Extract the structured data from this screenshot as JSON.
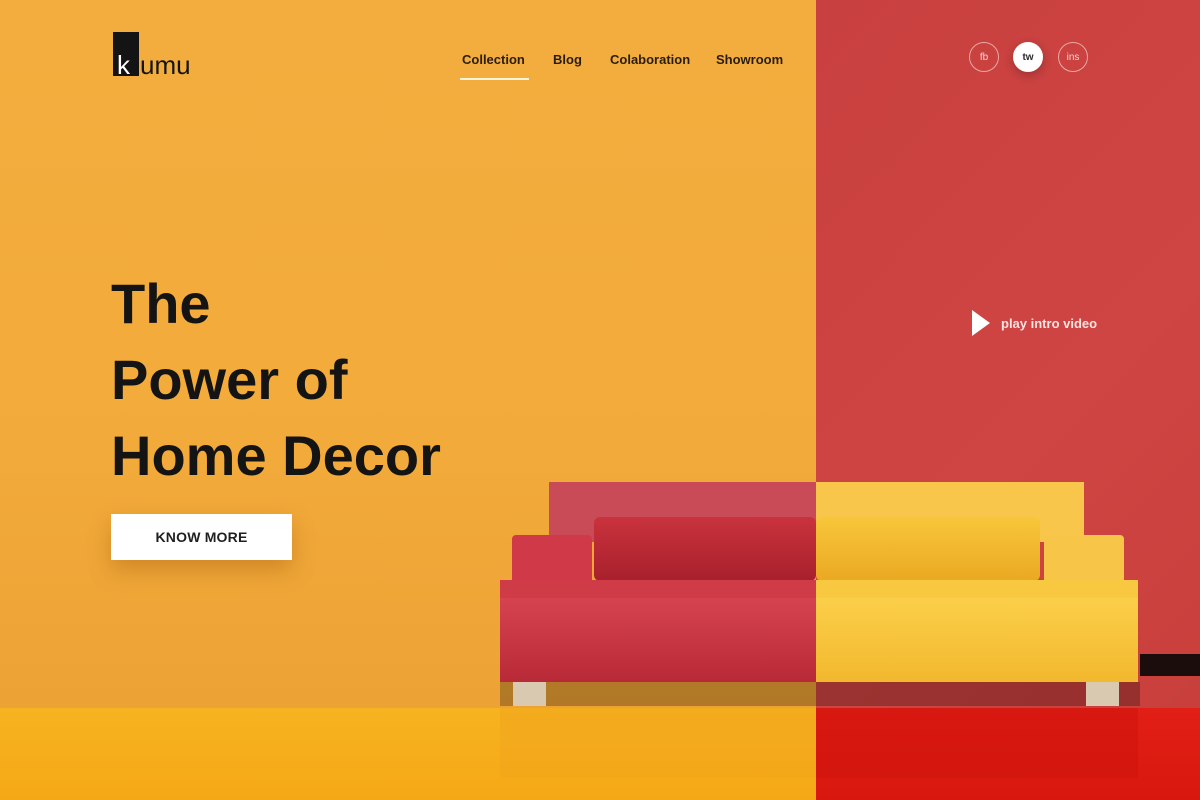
{
  "brand": {
    "logo_initial": "k",
    "logo_rest": "umu"
  },
  "nav": {
    "items": [
      {
        "label": "Collection",
        "active": true
      },
      {
        "label": "Blog",
        "active": false
      },
      {
        "label": "Colaboration",
        "active": false
      },
      {
        "label": "Showroom",
        "active": false
      }
    ]
  },
  "social": [
    {
      "label": "fb",
      "icon": "facebook-icon",
      "active": false
    },
    {
      "label": "tw",
      "icon": "twitter-icon",
      "active": true
    },
    {
      "label": "ins",
      "icon": "instagram-icon",
      "active": false
    }
  ],
  "hero": {
    "title_lines": [
      "The",
      "Power of",
      "Home Decor"
    ],
    "cta_label": "KNOW MORE"
  },
  "video": {
    "label": "play intro video",
    "icon": "play-icon"
  },
  "colors": {
    "wall_left": "#f2ad3e",
    "wall_right": "#c8403f",
    "floor_left": "#f7b321",
    "floor_right": "#e21f16",
    "sofa_red": "#c9333d",
    "sofa_yellow": "#f6c33c",
    "text_dark": "#141414",
    "button_bg": "#ffffff"
  }
}
